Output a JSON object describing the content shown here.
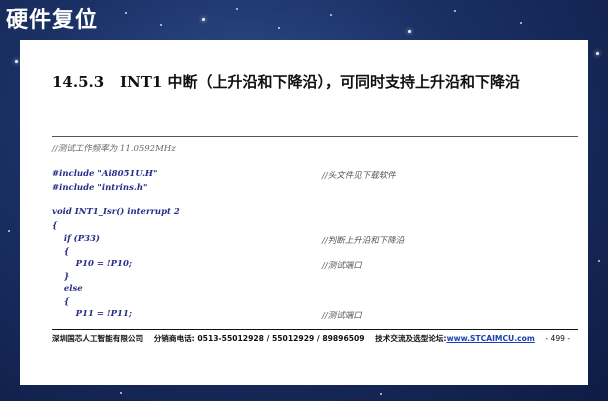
{
  "slide": {
    "title": "硬件复位"
  },
  "doc": {
    "heading_number": "14.5.3",
    "heading_text": "INT1 中断（上升沿和下降沿），可同时支持上升沿和下降沿",
    "freq_comment": "//测试工作频率为 11.0592MHz",
    "code_lines": [
      {
        "code": "#include \"Ai8051U.H\"",
        "comment": "//头文件见下载软件"
      },
      {
        "code": "#include \"intrins.h\"",
        "comment": ""
      },
      {
        "code": "void INT1_Isr() interrupt 2",
        "comment": ""
      },
      {
        "code": "{",
        "comment": ""
      },
      {
        "code": "    if (P33)",
        "comment": "//判断上升沿和下降沿"
      },
      {
        "code": "    {",
        "comment": ""
      },
      {
        "code": "        P10 = !P10;",
        "comment": "//测试端口"
      },
      {
        "code": "    }",
        "comment": ""
      },
      {
        "code": "    else",
        "comment": ""
      },
      {
        "code": "    {",
        "comment": ""
      },
      {
        "code": "        P11 = !P11;",
        "comment": "//测试端口"
      }
    ],
    "footer": {
      "company": "深圳国芯人工智能有限公司",
      "phone_label": "分销商电话:",
      "phone": "0513-55012928 / 55012929 / 89896509",
      "forum_label": "技术交流及选型论坛:",
      "url": "www.STCAIMCU.com",
      "page": "- 499 -"
    }
  }
}
